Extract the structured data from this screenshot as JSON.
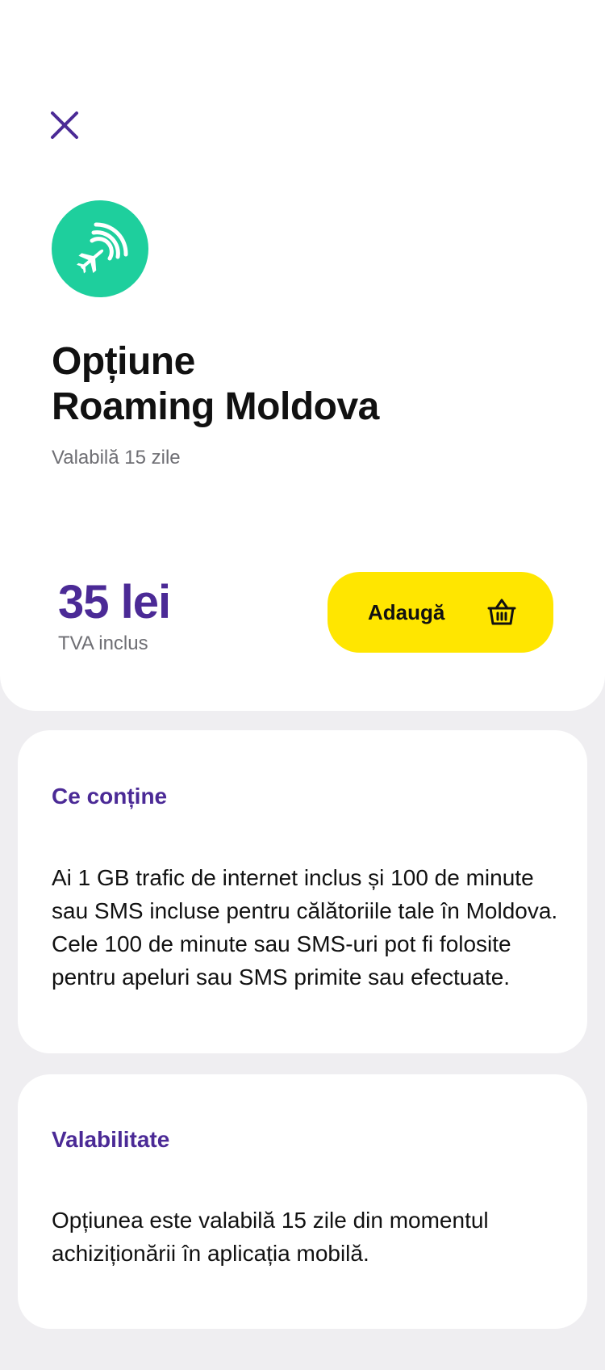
{
  "header": {
    "close_icon": "close-icon",
    "badge_icon": "plane-signal-icon",
    "title_line1": "Opțiune",
    "title_line2": "Roaming Moldova",
    "subtitle": "Valabilă 15 zile"
  },
  "pricing": {
    "price": "35 lei",
    "note": "TVA inclus",
    "add_label": "Adaugă",
    "add_icon": "basket-icon"
  },
  "sections": [
    {
      "title": "Ce conține",
      "body": "Ai 1 GB trafic de internet inclus și 100 de minute sau SMS incluse pentru călătoriile tale în Moldova. Cele 100 de minute sau SMS-uri pot fi folosite pentru apeluri sau SMS primite sau efectuate."
    },
    {
      "title": "Valabilitate",
      "body": "Opțiunea este valabilă 15 zile din momentul achiziționării în aplicația mobilă."
    }
  ],
  "colors": {
    "accent": "#4b2a96",
    "badge": "#1ecf9d",
    "button": "#ffe600",
    "background": "#efeef1"
  }
}
